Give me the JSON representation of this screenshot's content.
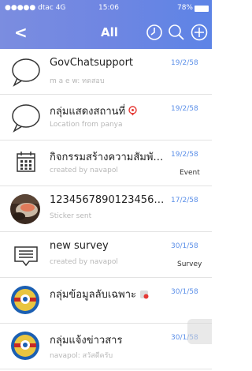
{
  "status_bar": {
    "signal": "●●●●● dtac  4G",
    "time": "15:06",
    "battery": "78%"
  },
  "header": {
    "back_icon": "chevron-left-icon",
    "title": "All",
    "icons": [
      "clock-icon",
      "search-icon",
      "add-icon"
    ]
  },
  "colors": {
    "header": "#6f86e2",
    "date": "#5b8fe8",
    "subtitle": "#b7b7b7"
  },
  "chats": [
    {
      "name": "GovChatsupport",
      "subtitle": "m a e w: ทดสอบ",
      "date": "19/2/58",
      "tag": "",
      "icon": "chat-bubble-icon"
    },
    {
      "name": "กลุ่มแสดงสถานที่",
      "subtitle": "Location from panya",
      "date": "19/2/58",
      "tag": "",
      "icon": "chat-bubble-icon"
    },
    {
      "name": "กิจกรรมสร้างความสัมพั…",
      "subtitle": "created by navapol",
      "date": "19/2/58",
      "tag": "Event",
      "icon": "calendar-icon"
    },
    {
      "name": "12345678901234567…",
      "subtitle": "Sticker sent",
      "date": "17/2/58",
      "tag": "",
      "icon": "food-photo-avatar"
    },
    {
      "name": "new survey",
      "subtitle": "created by navapol",
      "date": "30/1/58",
      "tag": "Survey",
      "icon": "survey-icon"
    },
    {
      "name": "กลุ่มข้อมูลลับเฉพาะ",
      "subtitle": "",
      "date": "30/1/58",
      "tag": "",
      "icon": "emblem-avatar"
    },
    {
      "name": "กลุ่มแจ้งข่าวสาร",
      "subtitle": "navapol: สวัสดีครับ",
      "date": "30/1/58",
      "tag": "",
      "icon": "emblem-avatar"
    }
  ]
}
